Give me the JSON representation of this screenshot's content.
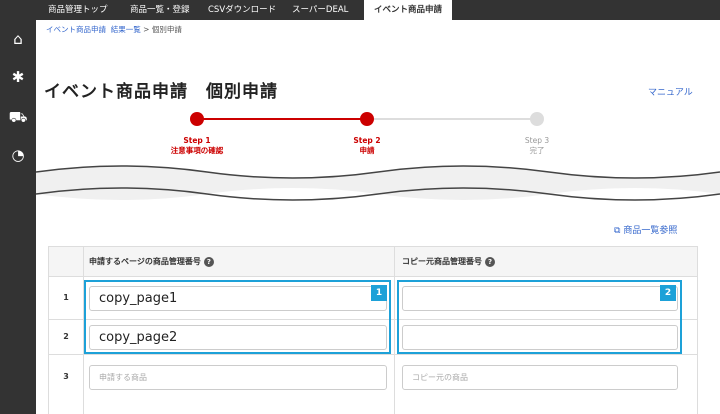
{
  "sidebar": {
    "items": [
      {
        "icon": "home-icon",
        "glyph": "⌂"
      },
      {
        "icon": "gear-icon",
        "glyph": "✱"
      },
      {
        "icon": "cart-icon",
        "glyph": "⛟"
      },
      {
        "icon": "chart-icon",
        "glyph": "◔"
      }
    ]
  },
  "nav": {
    "tabs": [
      {
        "label": "商品管理トップ"
      },
      {
        "label": "商品一覧・登録"
      },
      {
        "label": "CSVダウンロード"
      },
      {
        "label": "スーパーDEAL"
      },
      {
        "label": "イベント商品申請",
        "active": true
      }
    ]
  },
  "breadcrumb": {
    "item1": "イベント商品申請",
    "item2": "結果一覧",
    "separator": ">",
    "item3": "個別申請"
  },
  "page": {
    "title": "イベント商品申請　個別申請",
    "manual_link": "マニュアル",
    "list_link": "商品一覧参照"
  },
  "steps": [
    {
      "label": "Step 1",
      "sub": "注意事項の確認",
      "state": "done"
    },
    {
      "label": "Step 2",
      "sub": "申請",
      "state": "current"
    },
    {
      "label": "Step 3",
      "sub": "完了",
      "state": "pending"
    }
  ],
  "table": {
    "col1_header": "申請するページの商品管理番号",
    "col2_header": "コピー元商品管理番号",
    "rows": [
      {
        "num": "1",
        "page_value": "copy_page1",
        "copy_value": ""
      },
      {
        "num": "2",
        "page_value": "copy_page2",
        "copy_value": ""
      },
      {
        "num": "3",
        "page_placeholder": "申請する商品",
        "copy_placeholder": "コピー元の商品"
      }
    ]
  },
  "annotations": {
    "badge1": "1",
    "badge2": "2"
  },
  "colors": {
    "accent_red": "#cc0000",
    "highlight_blue": "#1da1d8",
    "nav_bg": "#333333"
  }
}
